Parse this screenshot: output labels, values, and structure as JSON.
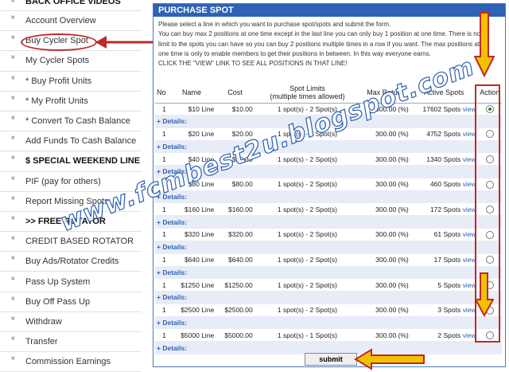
{
  "sidebar": {
    "items": [
      {
        "label": "BACK OFFICE VIDEOS",
        "header": true
      },
      {
        "label": "Account Overview"
      },
      {
        "label": "Buy Cycler Spot"
      },
      {
        "label": "My Cycler Spots"
      },
      {
        "label": "* Buy Profit Units"
      },
      {
        "label": "* My Profit Units"
      },
      {
        "label": "* Convert To Cash Balance"
      },
      {
        "label": "Add Funds To Cash Balance"
      },
      {
        "label": "$ SPECIAL WEEKEND LINE $",
        "header": true
      },
      {
        "label": "PIF (pay for others)"
      },
      {
        "label": "Report Missing Spots"
      },
      {
        "label": ">> FREE ROTATOR",
        "header": true
      },
      {
        "label": "CREDIT BASED ROTATOR"
      },
      {
        "label": "Buy Ads/Rotator Credits"
      },
      {
        "label": "Pass Up System"
      },
      {
        "label": "Buy Off Pass Up"
      },
      {
        "label": "Withdraw"
      },
      {
        "label": "Transfer"
      },
      {
        "label": "Commission Earnings"
      }
    ]
  },
  "panel": {
    "title": "PURCHASE SPOT",
    "instructions": [
      "Please select a line in which you want to purchase spot/spots and submit the form.",
      "You can buy max 2 positions at one time except in the last line you can only buy 1 position at one time. There is no",
      "limit to the spots you can have so you can buy 2 positions multiple times in a row if you want. The max positions at",
      "one time is only to enable members to get their positions in between. In this way everyone earns.",
      "CLICK THE \"VIEW\" LINK TO SEE ALL POSITIONS IN THAT LINE!"
    ]
  },
  "table": {
    "headers": {
      "no": "No",
      "name": "Name",
      "cost": "Cost",
      "limits": "Spot Limits",
      "limits_sub": "(multiple times allowed)",
      "return": "Max Return",
      "active": "Active Spots",
      "action": "Action"
    },
    "details_label": "+ Details:",
    "view_label": "view",
    "rows": [
      {
        "no": "1",
        "name": "$10 Line",
        "cost": "$10.00",
        "limits": "1 spot(s) - 2 Spot(s)",
        "ret": "300.00 (%)",
        "active": "17602 Spots",
        "selected": true
      },
      {
        "no": "1",
        "name": "$20 Line",
        "cost": "$20.00",
        "limits": "1 spot(s) - 2 Spot(s)",
        "ret": "300.00 (%)",
        "active": "4752 Spots",
        "selected": false
      },
      {
        "no": "1",
        "name": "$40 Line",
        "cost": "$40.00",
        "limits": "1 spot(s) - 2 Spot(s)",
        "ret": "300.00 (%)",
        "active": "1340 Spots",
        "selected": false
      },
      {
        "no": "1",
        "name": "$80 Line",
        "cost": "$80.00",
        "limits": "1 spot(s) - 2 Spot(s)",
        "ret": "300.00 (%)",
        "active": "460 Spots",
        "selected": false
      },
      {
        "no": "1",
        "name": "$160 Line",
        "cost": "$160.00",
        "limits": "1 spot(s) - 2 Spot(s)",
        "ret": "300.00 (%)",
        "active": "172 Spots",
        "selected": false
      },
      {
        "no": "1",
        "name": "$320 Line",
        "cost": "$320.00",
        "limits": "1 spot(s) - 2 Spot(s)",
        "ret": "300.00 (%)",
        "active": "61 Spots",
        "selected": false
      },
      {
        "no": "1",
        "name": "$640 Line",
        "cost": "$640.00",
        "limits": "1 spot(s) - 2 Spot(s)",
        "ret": "300.00 (%)",
        "active": "17 Spots",
        "selected": false
      },
      {
        "no": "1",
        "name": "$1250 Line",
        "cost": "$1250.00",
        "limits": "1 spot(s) - 2 Spot(s)",
        "ret": "300.00 (%)",
        "active": "5 Spots",
        "selected": false
      },
      {
        "no": "1",
        "name": "$2500 Line",
        "cost": "$2500.00",
        "limits": "1 spot(s) - 2 Spot(s)",
        "ret": "300.00 (%)",
        "active": "3 Spots",
        "selected": false
      },
      {
        "no": "1",
        "name": "$5000 Line",
        "cost": "$5000.00",
        "limits": "1 spot(s) - 1 Spot(s)",
        "ret": "300.00 (%)",
        "active": "2 Spots",
        "selected": false
      }
    ]
  },
  "submit_label": "submit",
  "watermark": "www.fcmbest2u.blogspot.com",
  "colors": {
    "accent": "#2e62b5",
    "annotation": "#c0282a",
    "arrow_fill": "#f2c200"
  },
  "icons": {
    "bullet": "chevron-down-icon",
    "radio": "radio-icon",
    "annotation_arrow": "arrow-icon"
  }
}
